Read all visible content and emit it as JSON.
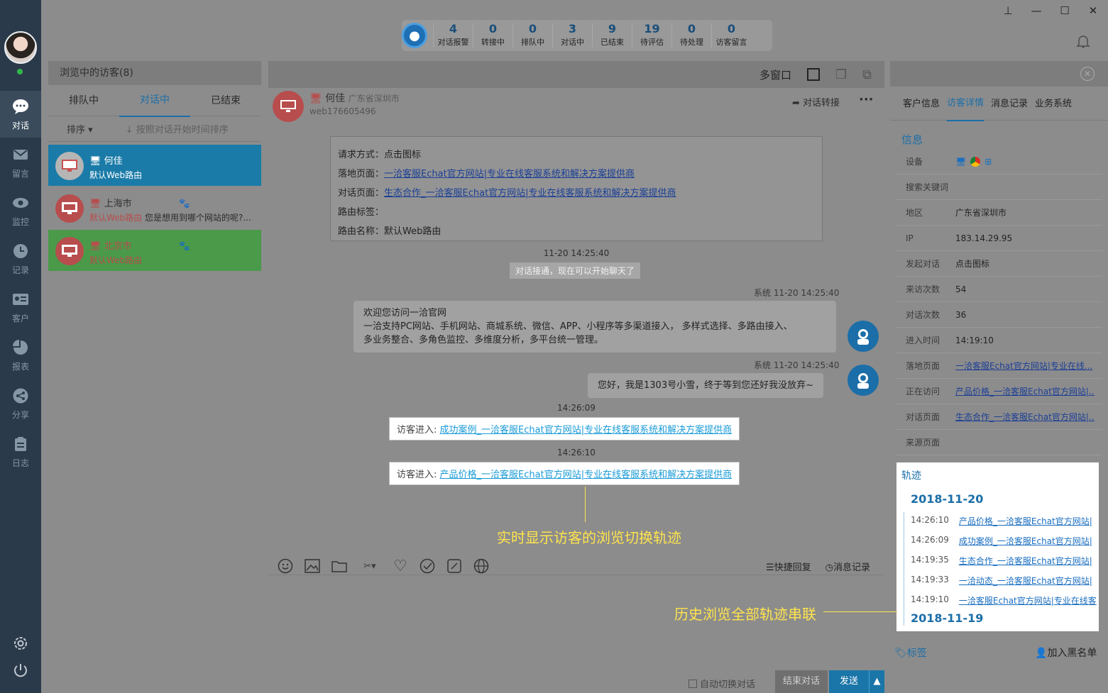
{
  "rail": {
    "items": [
      {
        "label": "对话",
        "icon": "chat-bubble-icon"
      },
      {
        "label": "留言",
        "icon": "mail-icon"
      },
      {
        "label": "监控",
        "icon": "eye-icon"
      },
      {
        "label": "记录",
        "icon": "clock-icon"
      },
      {
        "label": "客户",
        "icon": "id-card-icon"
      },
      {
        "label": "报表",
        "icon": "pie-chart-icon"
      },
      {
        "label": "分享",
        "icon": "share-icon"
      },
      {
        "label": "日志",
        "icon": "clipboard-icon"
      }
    ]
  },
  "stats": [
    {
      "n": "4",
      "l": "对话报警"
    },
    {
      "n": "0",
      "l": "转接中"
    },
    {
      "n": "0",
      "l": "排队中"
    },
    {
      "n": "3",
      "l": "对话中"
    },
    {
      "n": "9",
      "l": "已结束"
    },
    {
      "n": "19",
      "l": "待评估"
    },
    {
      "n": "0",
      "l": "待处理"
    },
    {
      "n": "0",
      "l": "访客留言"
    }
  ],
  "visitors": {
    "title": "浏览中的访客(8)",
    "tabs": [
      "排队中",
      "对话中",
      "已结束"
    ],
    "sort_label": "排序",
    "sort_hint": "按照对话开始时间排序",
    "items": [
      {
        "name": "何佳",
        "sub": "默认Web路由",
        "msg": ""
      },
      {
        "name": "上海市",
        "sub": "默认Web路由",
        "msg": "您是想用到哪个网站的呢?..."
      },
      {
        "name": "北京市",
        "sub": "默认Web路由",
        "msg": ""
      }
    ]
  },
  "chat": {
    "multiwindow": "多窗口",
    "visitor_name": "何佳",
    "visitor_loc": "广东省深圳市",
    "visitor_id": "web176605496",
    "transfer": "对话转接",
    "info": {
      "method_k": "请求方式：",
      "method_v": "点击图标",
      "landing_k": "落地页面：",
      "landing_v": "一洽客服Echat官方网站|专业在线客服系统和解决方案提供商",
      "chatpage_k": "对话页面：",
      "chatpage_v": "生态合作_一洽客服Echat官方网站|专业在线客服系统和解决方案提供商",
      "routetag_k": "路由标签：",
      "routename_k": "路由名称：",
      "routename_v": "默认Web路由"
    },
    "t1": "11-20 14:25:40",
    "connected": "对话接通，现在可以开始聊天了",
    "sys1_time": "系统 11-20 14:25:40",
    "sys1_line1": "欢迎您访问一洽官网",
    "sys1_line2": "一洽支持PC网站、手机网站、商城系统、微信、APP、小程序等多渠道接入， 多样式选择、多路由接入、",
    "sys1_line3": "多业务整合、多角色监控、多维度分析，多平台统一管理。",
    "sys2_time": "系统 11-20 14:25:40",
    "sys2_text": "您好，我是1303号小雪，终于等到您还好我没放弃~",
    "t2": "14:26:09",
    "enter_label": "访客进入:",
    "enter1": "成功案例_一洽客服Echat官方网站|专业在线客服系统和解决方案提供商",
    "t3": "14:26:10",
    "enter2": "产品价格_一洽客服Echat官方网站|专业在线客服系统和解决方案提供商",
    "annot1": "实时显示访客的浏览切换轨迹",
    "quick_reply": "快捷回复",
    "msg_record": "消息记录",
    "auto_switch": "自动切换对话",
    "end_chat": "结束对话",
    "send": "发送"
  },
  "right": {
    "tabs": [
      "客户信息",
      "访客详情",
      "消息记录",
      "业务系统"
    ],
    "section": "信息",
    "rows": [
      {
        "k": "设备",
        "v": ""
      },
      {
        "k": "搜索关键词",
        "v": ""
      },
      {
        "k": "地区",
        "v": "广东省深圳市"
      },
      {
        "k": "IP",
        "v": "183.14.29.95"
      },
      {
        "k": "发起对话",
        "v": "点击图标"
      },
      {
        "k": "来访次数",
        "v": "54"
      },
      {
        "k": "对话次数",
        "v": "36"
      },
      {
        "k": "进入时间",
        "v": "14:19:10"
      },
      {
        "k": "落地页面",
        "v": "一洽客服Echat官方网站|专业在线..."
      },
      {
        "k": "正在访问",
        "v": "产品价格_一洽客服Echat官方网站|..."
      },
      {
        "k": "对话页面",
        "v": "生态合作_一洽客服Echat官方网站|..."
      },
      {
        "k": "来源页面",
        "v": ""
      }
    ],
    "track_title": "轨迹",
    "date1": "2018-11-20",
    "track": [
      {
        "t": "14:26:10",
        "p": "产品价格_一洽客服Echat官方网站|"
      },
      {
        "t": "14:26:09",
        "p": "成功案例_一洽客服Echat官方网站|"
      },
      {
        "t": "14:19:35",
        "p": "生态合作_一洽客服Echat官方网站|"
      },
      {
        "t": "14:19:33",
        "p": "一洽动态_一洽客服Echat官方网站|"
      },
      {
        "t": "14:19:10",
        "p": "一洽客服Echat官方网站|专业在线客"
      }
    ],
    "date2": "2018-11-19",
    "annot2": "历史浏览全部轨迹串联",
    "tag": "标签",
    "blacklist": "加入黑名单"
  }
}
